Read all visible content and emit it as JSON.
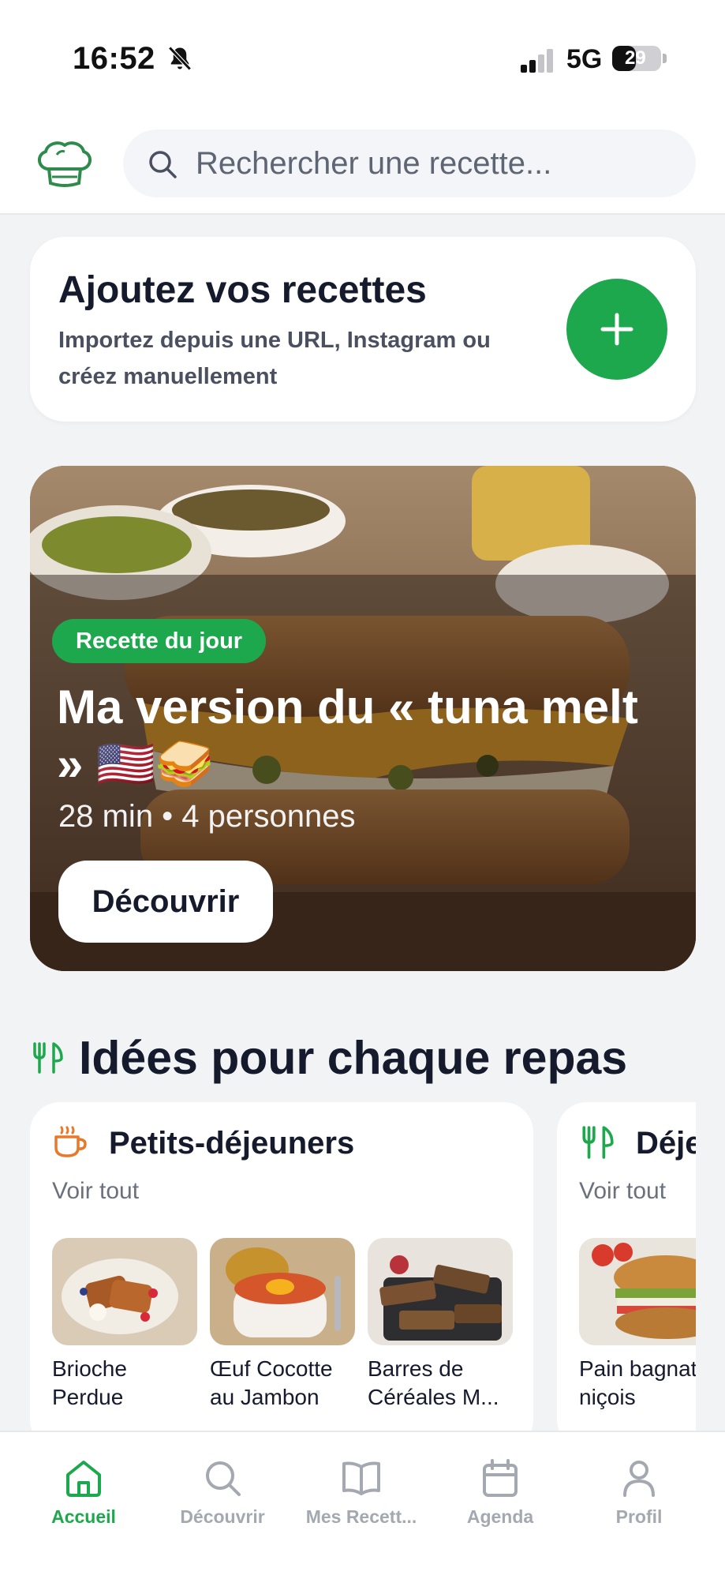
{
  "status_bar": {
    "time": "16:52",
    "network": "5G",
    "battery_level": "29",
    "battery_percent": 29,
    "bell_icon": "bell-slash-icon",
    "signal_icon": "signal-bars-icon"
  },
  "header": {
    "logo_icon": "chef-hat-icon",
    "search_placeholder": "Rechercher une recette..."
  },
  "add_card": {
    "title": "Ajoutez vos recettes",
    "subtitle": "Importez depuis une URL, Instagram ou créez manuellement",
    "button_icon": "plus-icon"
  },
  "daily_recipe": {
    "badge": "Recette du jour",
    "title": "Ma version du « tuna melt » 🇺🇸🥪",
    "meta": "28 min • 4 personnes",
    "button_label": "Découvrir"
  },
  "section": {
    "icon": "fork-knife-icon",
    "title": "Idées pour chaque repas"
  },
  "meal_categories": [
    {
      "title": "Petits-déjeuners",
      "icon": "coffee-cup-icon",
      "see_all": "Voir tout",
      "items": [
        {
          "name": "Brioche Perdue"
        },
        {
          "name": "Œuf Cocotte au Jambon"
        },
        {
          "name": "Barres de Céréales M..."
        }
      ]
    },
    {
      "title": "Déjeuners",
      "icon": "fork-knife-icon",
      "see_all": "Voir tout",
      "items": [
        {
          "name": "Pain bagnat niçois"
        }
      ]
    }
  ],
  "bottom_nav": {
    "items": [
      {
        "label": "Accueil",
        "icon": "home-icon",
        "active": true
      },
      {
        "label": "Découvrir",
        "icon": "search-icon",
        "active": false
      },
      {
        "label": "Mes Recett...",
        "icon": "book-icon",
        "active": false
      },
      {
        "label": "Agenda",
        "icon": "calendar-icon",
        "active": false
      },
      {
        "label": "Profil",
        "icon": "user-icon",
        "active": false
      }
    ]
  },
  "colors": {
    "accent": "#1ea84d",
    "text_dark": "#151a2d",
    "text_muted": "#6a707c",
    "nav_inactive": "#a4a8b0",
    "breakfast_icon": "#e8782a",
    "background": "#f2f3f5"
  }
}
